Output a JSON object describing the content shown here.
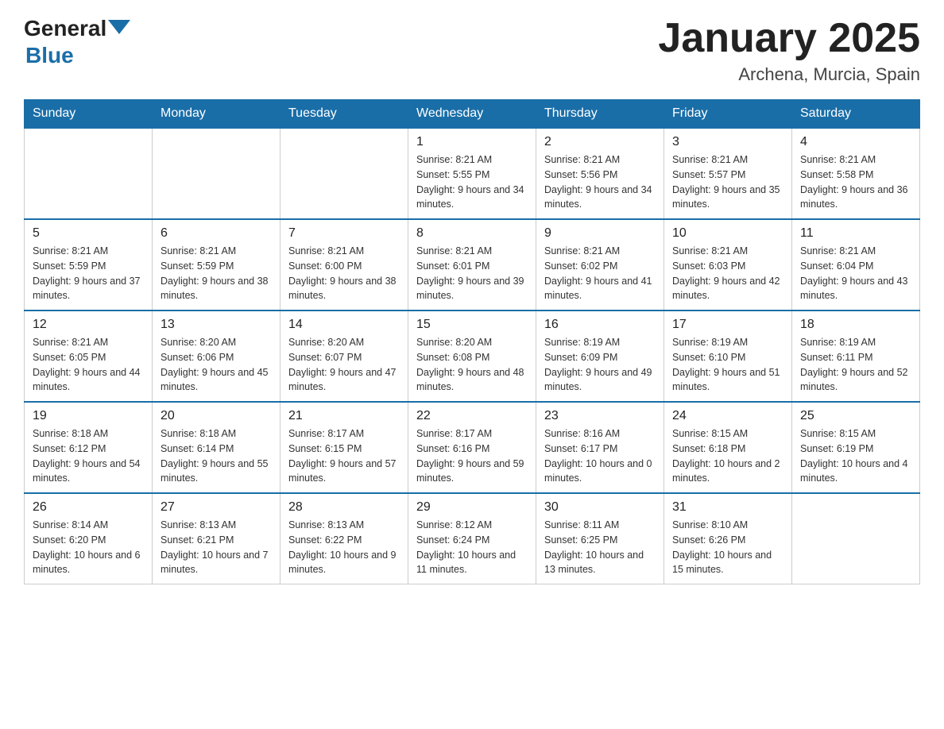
{
  "header": {
    "logo_general": "General",
    "logo_blue": "Blue",
    "title": "January 2025",
    "location": "Archena, Murcia, Spain"
  },
  "days_of_week": [
    "Sunday",
    "Monday",
    "Tuesday",
    "Wednesday",
    "Thursday",
    "Friday",
    "Saturday"
  ],
  "weeks": [
    [
      {
        "day": "",
        "info": ""
      },
      {
        "day": "",
        "info": ""
      },
      {
        "day": "",
        "info": ""
      },
      {
        "day": "1",
        "info": "Sunrise: 8:21 AM\nSunset: 5:55 PM\nDaylight: 9 hours\nand 34 minutes."
      },
      {
        "day": "2",
        "info": "Sunrise: 8:21 AM\nSunset: 5:56 PM\nDaylight: 9 hours\nand 34 minutes."
      },
      {
        "day": "3",
        "info": "Sunrise: 8:21 AM\nSunset: 5:57 PM\nDaylight: 9 hours\nand 35 minutes."
      },
      {
        "day": "4",
        "info": "Sunrise: 8:21 AM\nSunset: 5:58 PM\nDaylight: 9 hours\nand 36 minutes."
      }
    ],
    [
      {
        "day": "5",
        "info": "Sunrise: 8:21 AM\nSunset: 5:59 PM\nDaylight: 9 hours\nand 37 minutes."
      },
      {
        "day": "6",
        "info": "Sunrise: 8:21 AM\nSunset: 5:59 PM\nDaylight: 9 hours\nand 38 minutes."
      },
      {
        "day": "7",
        "info": "Sunrise: 8:21 AM\nSunset: 6:00 PM\nDaylight: 9 hours\nand 38 minutes."
      },
      {
        "day": "8",
        "info": "Sunrise: 8:21 AM\nSunset: 6:01 PM\nDaylight: 9 hours\nand 39 minutes."
      },
      {
        "day": "9",
        "info": "Sunrise: 8:21 AM\nSunset: 6:02 PM\nDaylight: 9 hours\nand 41 minutes."
      },
      {
        "day": "10",
        "info": "Sunrise: 8:21 AM\nSunset: 6:03 PM\nDaylight: 9 hours\nand 42 minutes."
      },
      {
        "day": "11",
        "info": "Sunrise: 8:21 AM\nSunset: 6:04 PM\nDaylight: 9 hours\nand 43 minutes."
      }
    ],
    [
      {
        "day": "12",
        "info": "Sunrise: 8:21 AM\nSunset: 6:05 PM\nDaylight: 9 hours\nand 44 minutes."
      },
      {
        "day": "13",
        "info": "Sunrise: 8:20 AM\nSunset: 6:06 PM\nDaylight: 9 hours\nand 45 minutes."
      },
      {
        "day": "14",
        "info": "Sunrise: 8:20 AM\nSunset: 6:07 PM\nDaylight: 9 hours\nand 47 minutes."
      },
      {
        "day": "15",
        "info": "Sunrise: 8:20 AM\nSunset: 6:08 PM\nDaylight: 9 hours\nand 48 minutes."
      },
      {
        "day": "16",
        "info": "Sunrise: 8:19 AM\nSunset: 6:09 PM\nDaylight: 9 hours\nand 49 minutes."
      },
      {
        "day": "17",
        "info": "Sunrise: 8:19 AM\nSunset: 6:10 PM\nDaylight: 9 hours\nand 51 minutes."
      },
      {
        "day": "18",
        "info": "Sunrise: 8:19 AM\nSunset: 6:11 PM\nDaylight: 9 hours\nand 52 minutes."
      }
    ],
    [
      {
        "day": "19",
        "info": "Sunrise: 8:18 AM\nSunset: 6:12 PM\nDaylight: 9 hours\nand 54 minutes."
      },
      {
        "day": "20",
        "info": "Sunrise: 8:18 AM\nSunset: 6:14 PM\nDaylight: 9 hours\nand 55 minutes."
      },
      {
        "day": "21",
        "info": "Sunrise: 8:17 AM\nSunset: 6:15 PM\nDaylight: 9 hours\nand 57 minutes."
      },
      {
        "day": "22",
        "info": "Sunrise: 8:17 AM\nSunset: 6:16 PM\nDaylight: 9 hours\nand 59 minutes."
      },
      {
        "day": "23",
        "info": "Sunrise: 8:16 AM\nSunset: 6:17 PM\nDaylight: 10 hours\nand 0 minutes."
      },
      {
        "day": "24",
        "info": "Sunrise: 8:15 AM\nSunset: 6:18 PM\nDaylight: 10 hours\nand 2 minutes."
      },
      {
        "day": "25",
        "info": "Sunrise: 8:15 AM\nSunset: 6:19 PM\nDaylight: 10 hours\nand 4 minutes."
      }
    ],
    [
      {
        "day": "26",
        "info": "Sunrise: 8:14 AM\nSunset: 6:20 PM\nDaylight: 10 hours\nand 6 minutes."
      },
      {
        "day": "27",
        "info": "Sunrise: 8:13 AM\nSunset: 6:21 PM\nDaylight: 10 hours\nand 7 minutes."
      },
      {
        "day": "28",
        "info": "Sunrise: 8:13 AM\nSunset: 6:22 PM\nDaylight: 10 hours\nand 9 minutes."
      },
      {
        "day": "29",
        "info": "Sunrise: 8:12 AM\nSunset: 6:24 PM\nDaylight: 10 hours\nand 11 minutes."
      },
      {
        "day": "30",
        "info": "Sunrise: 8:11 AM\nSunset: 6:25 PM\nDaylight: 10 hours\nand 13 minutes."
      },
      {
        "day": "31",
        "info": "Sunrise: 8:10 AM\nSunset: 6:26 PM\nDaylight: 10 hours\nand 15 minutes."
      },
      {
        "day": "",
        "info": ""
      }
    ]
  ]
}
